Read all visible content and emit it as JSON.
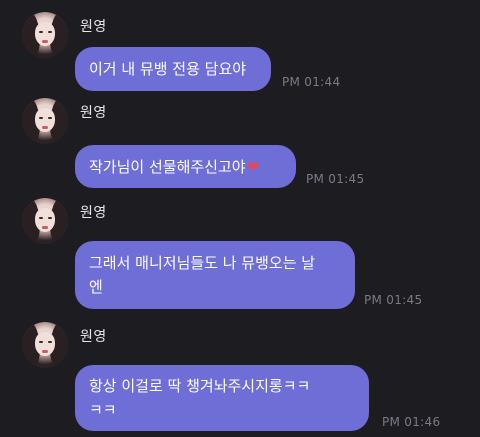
{
  "sender": "원영",
  "messages": [
    {
      "text": "이거 내 뮤뱅 전용 담요야",
      "time": "PM 01:44"
    },
    {
      "text": "작가님이 선물해주신고야",
      "emoji": "❤",
      "time": "PM 01:45"
    },
    {
      "line1": "그래서 매니저님들도 나 뮤뱅오는 날",
      "line2": "엔",
      "time": "PM 01:45"
    },
    {
      "line1": "항상 이걸로 딱 챙겨놔주시지롱ㅋㅋ",
      "line2": "ㅋㅋ",
      "time": "PM 01:46"
    }
  ],
  "icons": {
    "avatar": "profile-photo",
    "emoji": "red-heart"
  },
  "colors": {
    "background": "#1d1c21",
    "bubble": "#6f6dd6",
    "time": "#7b7985",
    "name": "#e8e6ec"
  }
}
